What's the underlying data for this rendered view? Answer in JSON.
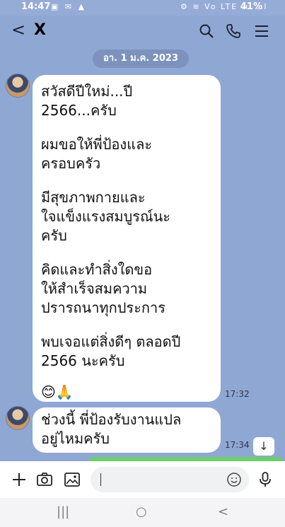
{
  "status": {
    "time": "14:47",
    "battery": "41%",
    "left_icons": "▣ ✉ ▲",
    "right_icons": "⚙ ≋ Vo LTE .ıl .ıl"
  },
  "header": {
    "back_icon": "chevron-left",
    "title": "X",
    "search_icon": "search",
    "call_icon": "phone",
    "menu_icon": "hamburger-menu"
  },
  "date_chip": "อา. 1 ม.ค. 2023",
  "messages": [
    {
      "lines": [
        "สวัสดีปีใหม่...ปี\n2566...ครับ",
        "ผมขอให้พี่ป้องและ\nครอบครัว",
        "มีสุขภาพกายและ\nใจแข็งแรงสมบูรณ์นะ\nครับ",
        "คิดและทำสิ่งใดขอ\nให้สำเร็จสมความ\nปรารถนาทุกประการ",
        "พบเจอแต่สิ่งดีๆ ตลอดปี\n2566 นะครับ"
      ],
      "emoji": "😊🙏",
      "time": "17:32"
    },
    {
      "lines": [
        "ช่วงนี้ พี่ป้องรับงานแปล\nอยู่ไหมครับ"
      ],
      "time": "17:34"
    }
  ],
  "scroll_down_icon": "↓",
  "input": {
    "placeholder": "",
    "value": ""
  },
  "nav": {
    "recents": "|||",
    "home": "○",
    "back": "<"
  },
  "colors": {
    "background": "#8fa7d3",
    "bubble": "#ffffff",
    "sent_bubble": "#6ccf6a"
  }
}
